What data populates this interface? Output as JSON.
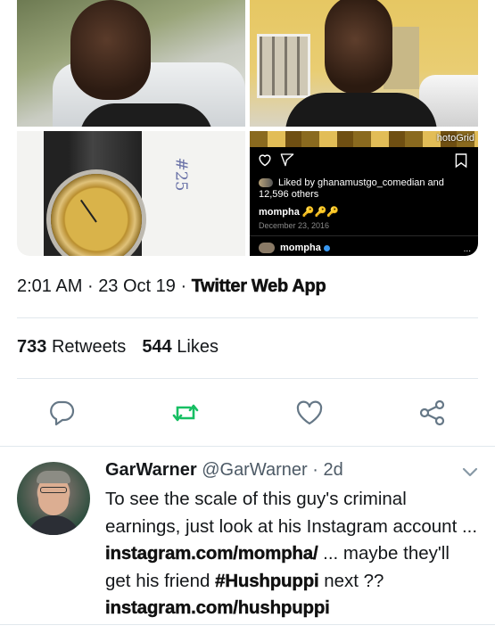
{
  "photo_grid": {
    "tile4": {
      "watermark": "hotoGrid",
      "liked_by": "Liked by ghanamustgo_comedian and",
      "liked_count": "12,596 others",
      "username": "mompha",
      "keys": "🔑🔑🔑",
      "date": "December 23, 2016",
      "username2": "mompha",
      "more": "..."
    },
    "tile3": {
      "scribble": "#25"
    }
  },
  "tweet": {
    "time": "2:01 AM",
    "dot1": "·",
    "date": "23 Oct 19",
    "dot2": "·",
    "source": "Twitter Web App",
    "retweets_count": "733",
    "retweets_label": "Retweets",
    "likes_count": "544",
    "likes_label": "Likes",
    "action_colors": {
      "reply": "#657786",
      "retweet": "#17bf63",
      "like": "#657786",
      "share": "#657786"
    }
  },
  "reply": {
    "name": "GarWarner",
    "handle": "@GarWarner",
    "dot": "·",
    "age": "2d",
    "text_1": "To see the scale of this guy's criminal earnings, just look at his Instagram account ... ",
    "link_1": "instagram.com/mompha/",
    "text_2": " ... maybe they'll get his friend ",
    "hashtag": "#Hushpuppi",
    "text_3": " next ?? ",
    "link_2": "instagram.com/hushpuppi"
  }
}
